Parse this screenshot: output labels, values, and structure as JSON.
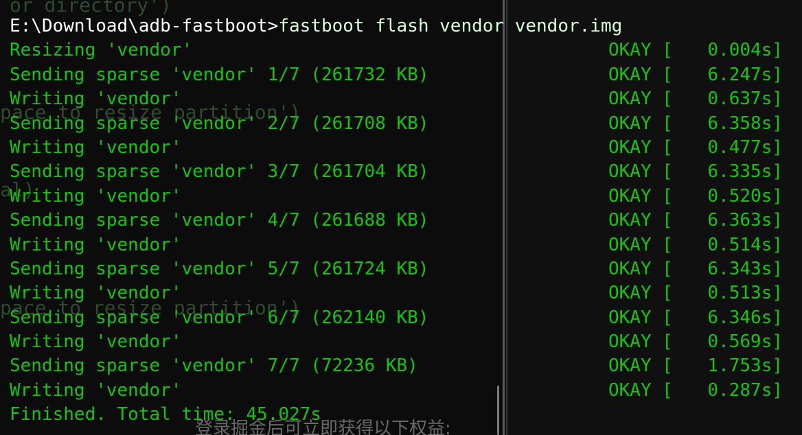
{
  "terminal": {
    "command_line": {
      "prompt": "E:\\Download\\adb-fastboot>",
      "command": "fastboot flash vendor vendor.img"
    },
    "lines": [
      {
        "text": "Resizing 'vendor'",
        "status": "OKAY [",
        "time": "0.004s]"
      },
      {
        "text": "Sending sparse 'vendor' 1/7 (261732 KB)",
        "status": "OKAY [",
        "time": "6.247s]"
      },
      {
        "text": "Writing 'vendor'",
        "status": "OKAY [",
        "time": "0.637s]"
      },
      {
        "text": "Sending sparse 'vendor' 2/7 (261708 KB)",
        "status": "OKAY [",
        "time": "6.358s]"
      },
      {
        "text": "Writing 'vendor'",
        "status": "OKAY [",
        "time": "0.477s]"
      },
      {
        "text": "Sending sparse 'vendor' 3/7 (261704 KB)",
        "status": "OKAY [",
        "time": "6.335s]"
      },
      {
        "text": "Writing 'vendor'",
        "status": "OKAY [",
        "time": "0.520s]"
      },
      {
        "text": "Sending sparse 'vendor' 4/7 (261688 KB)",
        "status": "OKAY [",
        "time": "6.363s]"
      },
      {
        "text": "Writing 'vendor'",
        "status": "OKAY [",
        "time": "0.514s]"
      },
      {
        "text": "Sending sparse 'vendor' 5/7 (261724 KB)",
        "status": "OKAY [",
        "time": "6.343s]"
      },
      {
        "text": "Writing 'vendor'",
        "status": "OKAY [",
        "time": "0.513s]"
      },
      {
        "text": "Sending sparse 'vendor' 6/7 (262140 KB)",
        "status": "OKAY [",
        "time": "6.346s]"
      },
      {
        "text": "Writing 'vendor'",
        "status": "OKAY [",
        "time": "0.569s]"
      },
      {
        "text": "Sending sparse 'vendor' 7/7 (72236 KB)",
        "status": "OKAY [",
        "time": "1.753s]"
      },
      {
        "text": "Writing 'vendor'",
        "status": "OKAY [",
        "time": "0.287s]"
      }
    ],
    "finished": "Finished. Total time: 45.027s",
    "ghost_text": {
      "top": "or directory')",
      "resize_1": "pace to resize partition')",
      "short": "al)",
      "resize_2": "pace to resize partition')",
      "bottom_cn": "登录掘金后可立即获得以下权益:"
    }
  },
  "colors": {
    "background": "#0c0c0c",
    "text_green": "#16c60c",
    "ghost": "#2f4a2f"
  }
}
